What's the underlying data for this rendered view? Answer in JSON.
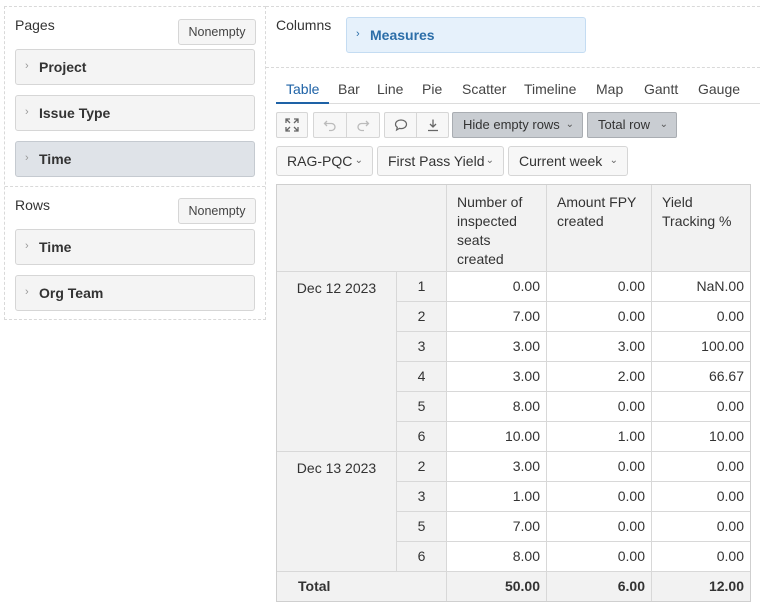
{
  "pages": {
    "title": "Pages",
    "nonempty_label": "Nonempty",
    "items": [
      {
        "label": "Project"
      },
      {
        "label": "Issue Type"
      },
      {
        "label": "Time"
      }
    ]
  },
  "rows": {
    "title": "Rows",
    "nonempty_label": "Nonempty",
    "items": [
      {
        "label": "Time"
      },
      {
        "label": "Org Team"
      }
    ]
  },
  "columns": {
    "title": "Columns",
    "measures_label": "Measures"
  },
  "tabs": [
    "Table",
    "Bar",
    "Line",
    "Pie",
    "Scatter",
    "Timeline",
    "Map",
    "Gantt",
    "Gauge"
  ],
  "active_tab": "Table",
  "toolbar": {
    "icons": [
      "fullscreen-icon",
      "undo-icon",
      "redo-icon",
      "comment-icon",
      "download-icon"
    ],
    "hide_empty_rows": "Hide empty rows",
    "total_row": "Total row"
  },
  "filters": [
    "RAG-PQC",
    "First Pass Yield",
    "Current week"
  ],
  "table": {
    "headers": [
      "Number of inspected seats created",
      "Amount FPY created",
      "Yield Tracking %"
    ],
    "groups": [
      {
        "date": "Dec 12 2023",
        "rows": [
          {
            "num": "1",
            "values": [
              "0.00",
              "0.00",
              "NaN.00"
            ]
          },
          {
            "num": "2",
            "values": [
              "7.00",
              "0.00",
              "0.00"
            ]
          },
          {
            "num": "3",
            "values": [
              "3.00",
              "3.00",
              "100.00"
            ]
          },
          {
            "num": "4",
            "values": [
              "3.00",
              "2.00",
              "66.67"
            ]
          },
          {
            "num": "5",
            "values": [
              "8.00",
              "0.00",
              "0.00"
            ]
          },
          {
            "num": "6",
            "values": [
              "10.00",
              "1.00",
              "10.00"
            ]
          }
        ]
      },
      {
        "date": "Dec 13 2023",
        "rows": [
          {
            "num": "2",
            "values": [
              "3.00",
              "0.00",
              "0.00"
            ]
          },
          {
            "num": "3",
            "values": [
              "1.00",
              "0.00",
              "0.00"
            ]
          },
          {
            "num": "5",
            "values": [
              "7.00",
              "0.00",
              "0.00"
            ]
          },
          {
            "num": "6",
            "values": [
              "8.00",
              "0.00",
              "0.00"
            ]
          }
        ]
      }
    ],
    "total": {
      "label": "Total",
      "values": [
        "50.00",
        "6.00",
        "12.00"
      ]
    }
  },
  "colors": {
    "accent": "#1e62a6",
    "measures_bg": "#e6f1fb",
    "header_bg": "#f2f2f2",
    "dropdown_bg": "#c9cdd2"
  }
}
